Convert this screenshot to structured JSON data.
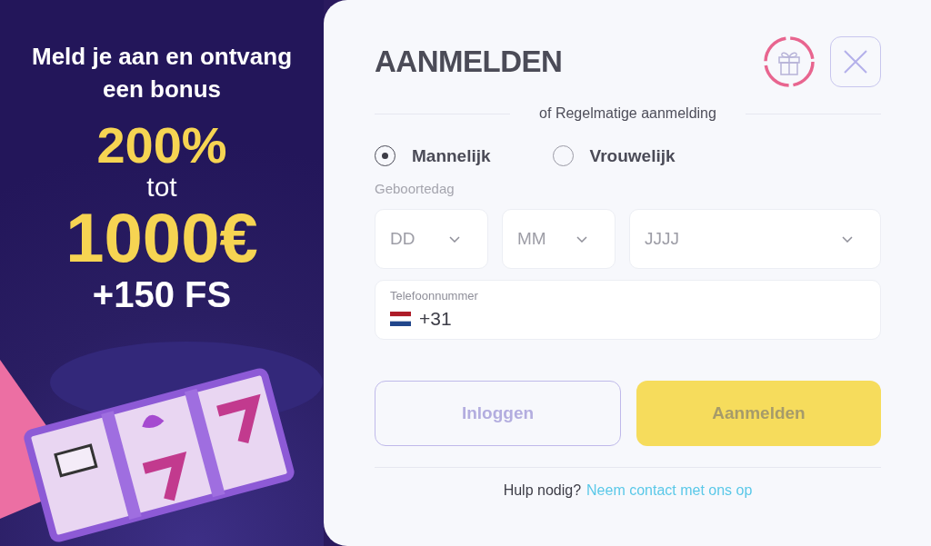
{
  "promo": {
    "headline": "Meld je aan en ontvang een bonus",
    "percent": "200%",
    "connector": "tot",
    "amount": "1000€",
    "extra": "+150 FS"
  },
  "form": {
    "title": "AANMELDEN",
    "divider_text": "of Regelmatige aanmelding",
    "gender_options": [
      {
        "label": "Mannelijk",
        "selected": true
      },
      {
        "label": "Vrouwelijk",
        "selected": false
      }
    ],
    "birthday_label": "Geboortedag",
    "birthday_fields": [
      {
        "placeholder": "DD"
      },
      {
        "placeholder": "MM"
      },
      {
        "placeholder": "JJJJ"
      }
    ],
    "phone": {
      "label": "Telefoonnummer",
      "country_code": "+31"
    },
    "buttons": [
      {
        "label": "Inloggen",
        "kind": "outline"
      },
      {
        "label": "Aanmelden",
        "kind": "primary"
      }
    ],
    "help_text": "Hulp nodig?",
    "help_link": "Neem contact met ons op"
  }
}
